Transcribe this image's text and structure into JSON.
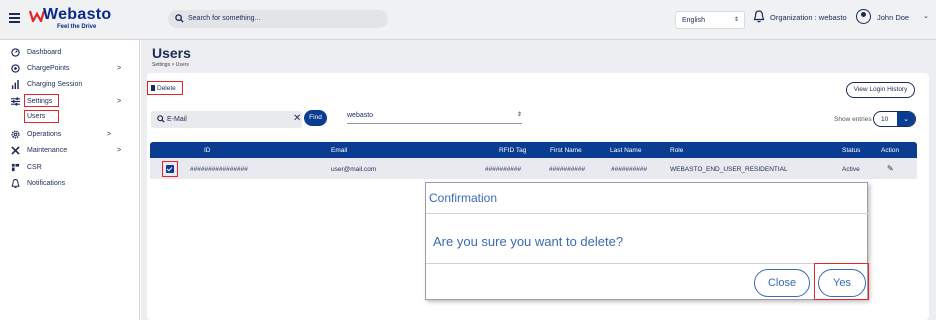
{
  "header": {
    "logo": "Webasto",
    "logo_tagline": "Feel the Drive",
    "search_placeholder": "Search for something...",
    "language": "English",
    "organization": "Organization : webasto",
    "user": "John Doe"
  },
  "sidebar": {
    "items": [
      {
        "label": "Dashboard",
        "icon": "dashboard-icon"
      },
      {
        "label": "ChargePoints",
        "icon": "chargepoint-icon",
        "arrow": ">"
      },
      {
        "label": "Charging Session",
        "icon": "bar-chart-icon"
      },
      {
        "label": "Settings",
        "icon": "sliders-icon",
        "arrow": ">"
      },
      {
        "label": "Users",
        "icon": ""
      },
      {
        "label": "Operations",
        "icon": "gear-icon",
        "arrow": ">"
      },
      {
        "label": "Maintenance",
        "icon": "tools-icon",
        "arrow": ">"
      },
      {
        "label": "CSR",
        "icon": "csr-icon"
      },
      {
        "label": "Notifications",
        "icon": "bell-icon"
      }
    ]
  },
  "page": {
    "title": "Users",
    "breadcrumb": "Settings > Users",
    "delete_label": "Delete",
    "view_login_history": "View Login History",
    "email_placeholder": "E-Mail",
    "find_label": "Find",
    "org_value": "webasto",
    "show_entries_label": "Show entries",
    "show_entries_value": "10"
  },
  "table": {
    "headers": [
      "ID",
      "Email",
      "RFID Tag",
      "First Name",
      "Last Name",
      "Role",
      "Status",
      "Action"
    ],
    "rows": [
      {
        "id": "################",
        "email": "user@mail.com",
        "rfid": "##########",
        "first": "##########",
        "last": "##########",
        "role": "WEBASTO_END_USER_RESIDENTIAL",
        "status": "Active"
      }
    ]
  },
  "dialog": {
    "title": "Confirmation",
    "message": "Are you sure you want to delete?",
    "close_label": "Close",
    "yes_label": "Yes"
  },
  "colors": {
    "accent": "#0a3d91",
    "highlight": "#e3262b",
    "dialog_text": "#3a6bb5"
  }
}
